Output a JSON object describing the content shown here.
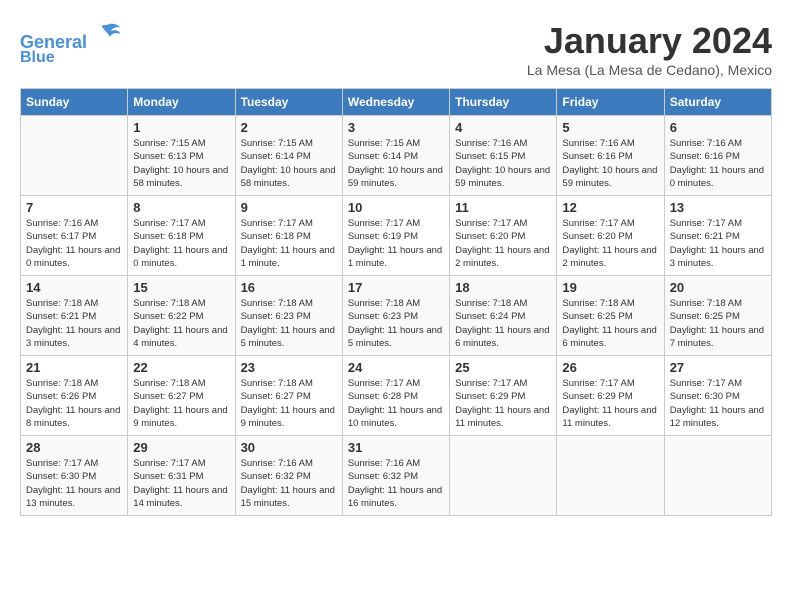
{
  "header": {
    "logo_line1": "General",
    "logo_line2": "Blue",
    "month": "January 2024",
    "location": "La Mesa (La Mesa de Cedano), Mexico"
  },
  "days_of_week": [
    "Sunday",
    "Monday",
    "Tuesday",
    "Wednesday",
    "Thursday",
    "Friday",
    "Saturday"
  ],
  "weeks": [
    [
      {
        "day": "",
        "empty": true
      },
      {
        "day": "1",
        "sunrise": "7:15 AM",
        "sunset": "6:13 PM",
        "daylight": "10 hours and 58 minutes."
      },
      {
        "day": "2",
        "sunrise": "7:15 AM",
        "sunset": "6:14 PM",
        "daylight": "10 hours and 58 minutes."
      },
      {
        "day": "3",
        "sunrise": "7:15 AM",
        "sunset": "6:14 PM",
        "daylight": "10 hours and 59 minutes."
      },
      {
        "day": "4",
        "sunrise": "7:16 AM",
        "sunset": "6:15 PM",
        "daylight": "10 hours and 59 minutes."
      },
      {
        "day": "5",
        "sunrise": "7:16 AM",
        "sunset": "6:16 PM",
        "daylight": "10 hours and 59 minutes."
      },
      {
        "day": "6",
        "sunrise": "7:16 AM",
        "sunset": "6:16 PM",
        "daylight": "11 hours and 0 minutes."
      }
    ],
    [
      {
        "day": "7",
        "sunrise": "7:16 AM",
        "sunset": "6:17 PM",
        "daylight": "11 hours and 0 minutes."
      },
      {
        "day": "8",
        "sunrise": "7:17 AM",
        "sunset": "6:18 PM",
        "daylight": "11 hours and 0 minutes."
      },
      {
        "day": "9",
        "sunrise": "7:17 AM",
        "sunset": "6:18 PM",
        "daylight": "11 hours and 1 minute."
      },
      {
        "day": "10",
        "sunrise": "7:17 AM",
        "sunset": "6:19 PM",
        "daylight": "11 hours and 1 minute."
      },
      {
        "day": "11",
        "sunrise": "7:17 AM",
        "sunset": "6:20 PM",
        "daylight": "11 hours and 2 minutes."
      },
      {
        "day": "12",
        "sunrise": "7:17 AM",
        "sunset": "6:20 PM",
        "daylight": "11 hours and 2 minutes."
      },
      {
        "day": "13",
        "sunrise": "7:17 AM",
        "sunset": "6:21 PM",
        "daylight": "11 hours and 3 minutes."
      }
    ],
    [
      {
        "day": "14",
        "sunrise": "7:18 AM",
        "sunset": "6:21 PM",
        "daylight": "11 hours and 3 minutes."
      },
      {
        "day": "15",
        "sunrise": "7:18 AM",
        "sunset": "6:22 PM",
        "daylight": "11 hours and 4 minutes."
      },
      {
        "day": "16",
        "sunrise": "7:18 AM",
        "sunset": "6:23 PM",
        "daylight": "11 hours and 5 minutes."
      },
      {
        "day": "17",
        "sunrise": "7:18 AM",
        "sunset": "6:23 PM",
        "daylight": "11 hours and 5 minutes."
      },
      {
        "day": "18",
        "sunrise": "7:18 AM",
        "sunset": "6:24 PM",
        "daylight": "11 hours and 6 minutes."
      },
      {
        "day": "19",
        "sunrise": "7:18 AM",
        "sunset": "6:25 PM",
        "daylight": "11 hours and 6 minutes."
      },
      {
        "day": "20",
        "sunrise": "7:18 AM",
        "sunset": "6:25 PM",
        "daylight": "11 hours and 7 minutes."
      }
    ],
    [
      {
        "day": "21",
        "sunrise": "7:18 AM",
        "sunset": "6:26 PM",
        "daylight": "11 hours and 8 minutes."
      },
      {
        "day": "22",
        "sunrise": "7:18 AM",
        "sunset": "6:27 PM",
        "daylight": "11 hours and 9 minutes."
      },
      {
        "day": "23",
        "sunrise": "7:18 AM",
        "sunset": "6:27 PM",
        "daylight": "11 hours and 9 minutes."
      },
      {
        "day": "24",
        "sunrise": "7:17 AM",
        "sunset": "6:28 PM",
        "daylight": "11 hours and 10 minutes."
      },
      {
        "day": "25",
        "sunrise": "7:17 AM",
        "sunset": "6:29 PM",
        "daylight": "11 hours and 11 minutes."
      },
      {
        "day": "26",
        "sunrise": "7:17 AM",
        "sunset": "6:29 PM",
        "daylight": "11 hours and 11 minutes."
      },
      {
        "day": "27",
        "sunrise": "7:17 AM",
        "sunset": "6:30 PM",
        "daylight": "11 hours and 12 minutes."
      }
    ],
    [
      {
        "day": "28",
        "sunrise": "7:17 AM",
        "sunset": "6:30 PM",
        "daylight": "11 hours and 13 minutes."
      },
      {
        "day": "29",
        "sunrise": "7:17 AM",
        "sunset": "6:31 PM",
        "daylight": "11 hours and 14 minutes."
      },
      {
        "day": "30",
        "sunrise": "7:16 AM",
        "sunset": "6:32 PM",
        "daylight": "11 hours and 15 minutes."
      },
      {
        "day": "31",
        "sunrise": "7:16 AM",
        "sunset": "6:32 PM",
        "daylight": "11 hours and 16 minutes."
      },
      {
        "day": "",
        "empty": true
      },
      {
        "day": "",
        "empty": true
      },
      {
        "day": "",
        "empty": true
      }
    ]
  ]
}
